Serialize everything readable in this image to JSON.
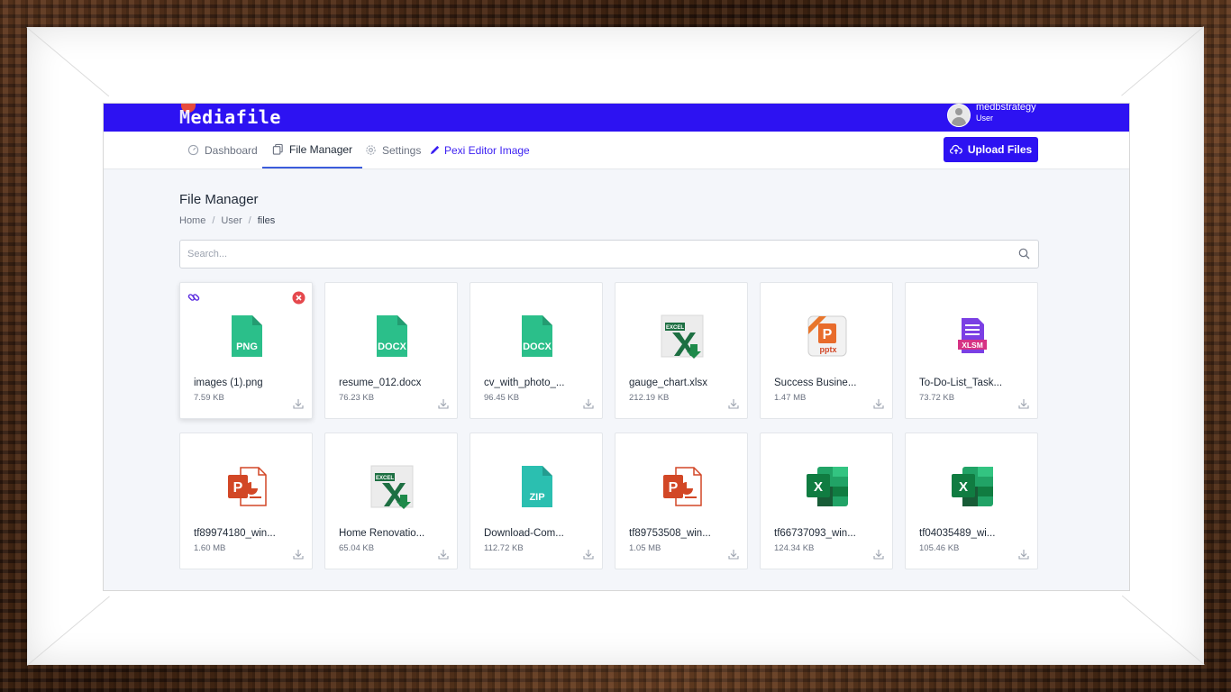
{
  "app": {
    "brand": "ediafile",
    "user": {
      "name": "medbstrategy",
      "role": "User"
    }
  },
  "nav": {
    "items": [
      {
        "label": "Dashboard",
        "icon": "dashboard-gauge-icon"
      },
      {
        "label": "File Manager",
        "icon": "files-copy-icon",
        "active": true
      },
      {
        "label": "Settings",
        "icon": "gear-icon"
      },
      {
        "label": "Pexi Editor Image",
        "icon": "pencil-icon"
      }
    ],
    "upload_label": "Upload Files"
  },
  "page": {
    "title": "File Manager",
    "breadcrumb": [
      "Home",
      "User",
      "files"
    ],
    "search": {
      "placeholder": "Search...",
      "value": ""
    }
  },
  "files": [
    {
      "name": "images (1).png",
      "size": "7.59 KB",
      "type": "png",
      "icon": "png-file-icon",
      "label": "PNG"
    },
    {
      "name": "resume_012.docx",
      "size": "76.23 KB",
      "type": "docx",
      "icon": "docx-file-icon",
      "label": "DOCX"
    },
    {
      "name": "cv_with_photo_...",
      "size": "96.45 KB",
      "type": "docx",
      "icon": "docx-file-icon",
      "label": "DOCX"
    },
    {
      "name": "gauge_chart.xlsx",
      "size": "212.19 KB",
      "type": "excel-legacy",
      "icon": "excel-file-icon",
      "label": "EXCEL"
    },
    {
      "name": "Success Busine...",
      "size": "1.47 MB",
      "type": "pptx-legacy",
      "icon": "pptx-file-icon",
      "label": "pptx"
    },
    {
      "name": "To-Do-List_Task...",
      "size": "73.72 KB",
      "type": "xlsm",
      "icon": "xlsm-file-icon",
      "label": "XLSM"
    },
    {
      "name": "tf89974180_win...",
      "size": "1.60 MB",
      "type": "ppt",
      "icon": "powerpoint-file-icon"
    },
    {
      "name": "Home Renovatio...",
      "size": "65.04 KB",
      "type": "excel-legacy",
      "icon": "excel-file-icon",
      "label": "EXCEL"
    },
    {
      "name": "Download-Com...",
      "size": "112.72 KB",
      "type": "zip",
      "icon": "zip-file-icon",
      "label": "ZIP"
    },
    {
      "name": "tf89753508_win...",
      "size": "1.05 MB",
      "type": "ppt",
      "icon": "powerpoint-file-icon"
    },
    {
      "name": "tf66737093_win...",
      "size": "124.34 KB",
      "type": "xlsx",
      "icon": "excel-file-icon",
      "label": "X"
    },
    {
      "name": "tf04035489_wi...",
      "size": "105.46 KB",
      "type": "xlsx",
      "icon": "excel-file-icon",
      "label": "X"
    }
  ],
  "colors": {
    "brand": "#2d12f2",
    "file_teal": "#2bbf8a",
    "zip_teal": "#2bbfb0",
    "excel_green": "#1d6f42",
    "ppt_orange": "#d24726",
    "delete_red": "#e5484d",
    "xlsm_purple": "#7b3fe4"
  }
}
